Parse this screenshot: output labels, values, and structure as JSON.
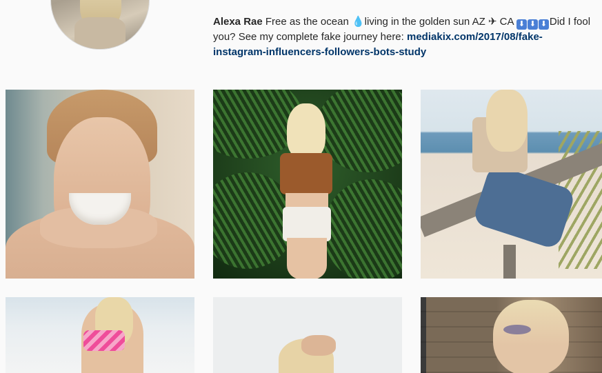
{
  "profile": {
    "username": "Alexa Rae",
    "bio_part1": "Free as the ocean ",
    "bio_drop": "💧",
    "bio_part2": "living in the golden sun AZ ✈ CA ",
    "bio_arrows": [
      "⬇",
      "⬇",
      "⬇"
    ],
    "bio_part3": "Did I fool",
    "bio_line2": "you? See my complete fake journey here: ",
    "link_part1": "mediakix.com/2017/08/fake-",
    "link_part2": "instagram-influencers-followers-bots-study"
  },
  "posts": [
    {
      "name": "coffee"
    },
    {
      "name": "palm-tree"
    },
    {
      "name": "beach-railing"
    },
    {
      "name": "bikini-beach"
    },
    {
      "name": "white-wall"
    },
    {
      "name": "wood-wall"
    }
  ],
  "colors": {
    "background": "#fafafa",
    "text": "#262626",
    "link": "#003569"
  }
}
